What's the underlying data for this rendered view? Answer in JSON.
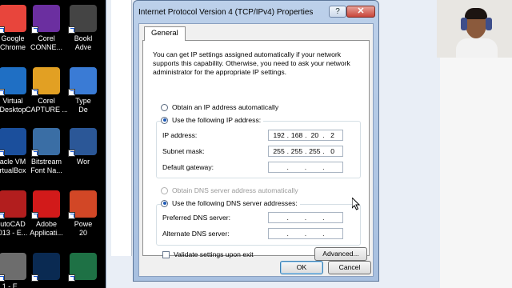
{
  "desktop": {
    "icons": [
      {
        "label": "Google\nChrome",
        "icon": "chrome-icon",
        "color": "#e8453c"
      },
      {
        "label": "Virtual\nDesktop",
        "icon": "monitor-icon",
        "color": "#1f6fc4"
      },
      {
        "label": "acle VM\nrtualBox",
        "icon": "virtualbox-icon",
        "color": "#1b4f9c"
      },
      {
        "label": "utoCAD\n013 - E...",
        "icon": "autocad-icon",
        "color": "#b21e1e"
      },
      {
        "label": "1 - E...",
        "icon": "app-icon",
        "color": "#6d6d6d"
      },
      {
        "label": "Corel\nCONNE...",
        "icon": "corel-connect-icon",
        "color": "#6b2fa0"
      },
      {
        "label": "Corel\nCAPTURE ...",
        "icon": "corel-capture-icon",
        "color": "#e2a023"
      },
      {
        "label": "Bitstream\nFont Na...",
        "icon": "bitstream-icon",
        "color": "#3a6ea5"
      },
      {
        "label": "Adobe\nApplicati...",
        "icon": "adobe-icon",
        "color": "#d21a1a"
      },
      {
        "label": "",
        "icon": "photoshop-icon",
        "color": "#0a2a52"
      },
      {
        "label": "Bookl\nAdve",
        "icon": "book-icon",
        "color": "#444444"
      },
      {
        "label": "Type\nDe",
        "icon": "type-icon",
        "color": "#3a7bd5"
      },
      {
        "label": "Wor",
        "icon": "word-icon",
        "color": "#2b5797"
      },
      {
        "label": "Powe\n20",
        "icon": "powerpoint-icon",
        "color": "#d24726"
      },
      {
        "label": "",
        "icon": "excel-icon",
        "color": "#1e7145"
      }
    ]
  },
  "dialog": {
    "title": "Internet Protocol Version 4 (TCP/IPv4) Properties",
    "help_label": "?",
    "close_label": "✕",
    "tab_general": "General",
    "description": "You can get IP settings assigned automatically if your network supports this capability. Otherwise, you need to ask your network administrator for the appropriate IP settings.",
    "radio_auto_ip": "Obtain an IP address automatically",
    "radio_static_ip": "Use the following IP address:",
    "ip_label": "IP address:",
    "ip_value": [
      "192",
      "168",
      "20",
      "2"
    ],
    "subnet_label": "Subnet mask:",
    "subnet_value": [
      "255",
      "255",
      "255",
      "0"
    ],
    "gateway_label": "Default gateway:",
    "gateway_value": [
      "",
      "",
      "",
      ""
    ],
    "radio_auto_dns": "Obtain DNS server address automatically",
    "radio_static_dns": "Use the following DNS server addresses:",
    "pref_dns_label": "Preferred DNS server:",
    "pref_dns_value": [
      "",
      "",
      "",
      ""
    ],
    "alt_dns_label": "Alternate DNS server:",
    "alt_dns_value": [
      "",
      "",
      "",
      ""
    ],
    "validate_label": "Validate settings upon exit",
    "advanced_label": "Advanced...",
    "ok_label": "OK",
    "cancel_label": "Cancel"
  }
}
